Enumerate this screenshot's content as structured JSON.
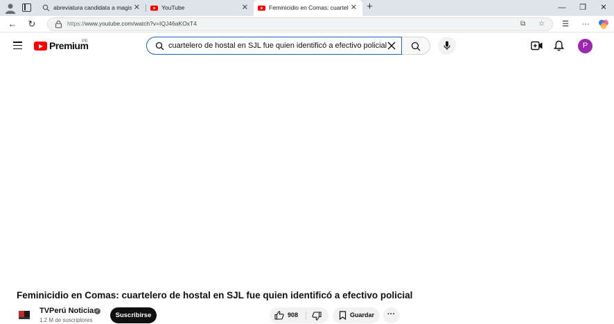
{
  "browser": {
    "tabs": [
      {
        "title": "abreviatura candidata a magis - B",
        "favicon": "search-icon",
        "active": false
      },
      {
        "title": "YouTube",
        "favicon": "youtube-icon",
        "active": false
      },
      {
        "title": "Feminicidio en Comas: cuartelero de",
        "favicon": "youtube-icon",
        "active": true
      }
    ],
    "new_tab_label": "+",
    "url_protocol": "https://",
    "url_rest": "www.youtube.com/watch?v=IQJ46aKOxT4"
  },
  "header": {
    "logo_text": "Premium",
    "region": "PE",
    "search_value": "cuartelero de hostal en SJL fue quien identificó a efectivo policial",
    "avatar_letter": "P"
  },
  "video": {
    "title": "Feminicidio en Comas: cuartelero de hostal en SJL fue quien identificó a efectivo policial",
    "channel_name": "TVPerú Noticias",
    "subscribers": "1.2 M de suscriptores",
    "subscribe_label": "Suscribirse",
    "like_count": "908",
    "save_label": "Guardar",
    "more_label": "···"
  },
  "colors": {
    "brand_red": "#ff0000",
    "avatar_purple": "#9c27b0",
    "search_focus": "#1c62b9"
  }
}
